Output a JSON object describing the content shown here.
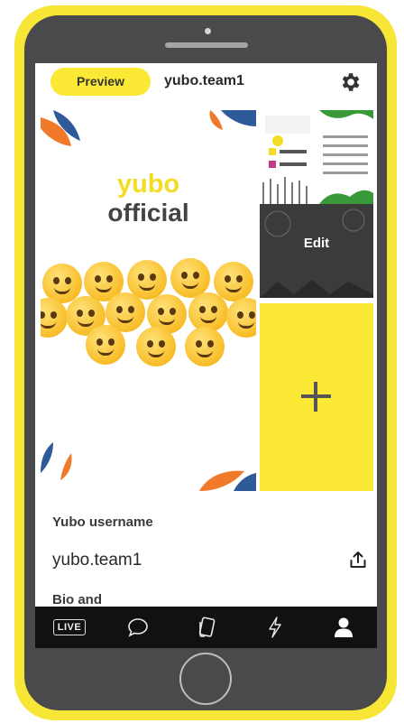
{
  "header": {
    "preview_label": "Preview",
    "username": "yubo.team1"
  },
  "main_photo": {
    "brand_line1": "yubo",
    "brand_line2": "official"
  },
  "thumbnail": {
    "edit_label": "Edit"
  },
  "add_tile": {
    "icon": "plus-icon"
  },
  "profile": {
    "username_label": "Yubo username",
    "username_value": "yubo.team1",
    "next_label": "Bio and"
  },
  "tabbar": {
    "live_label": "LIVE",
    "icons": [
      "live-icon",
      "chat-icon",
      "cards-icon",
      "bolt-icon",
      "profile-icon"
    ]
  },
  "colors": {
    "accent": "#fbe935",
    "frame": "#4a4a4c",
    "tabbar": "#111111"
  }
}
